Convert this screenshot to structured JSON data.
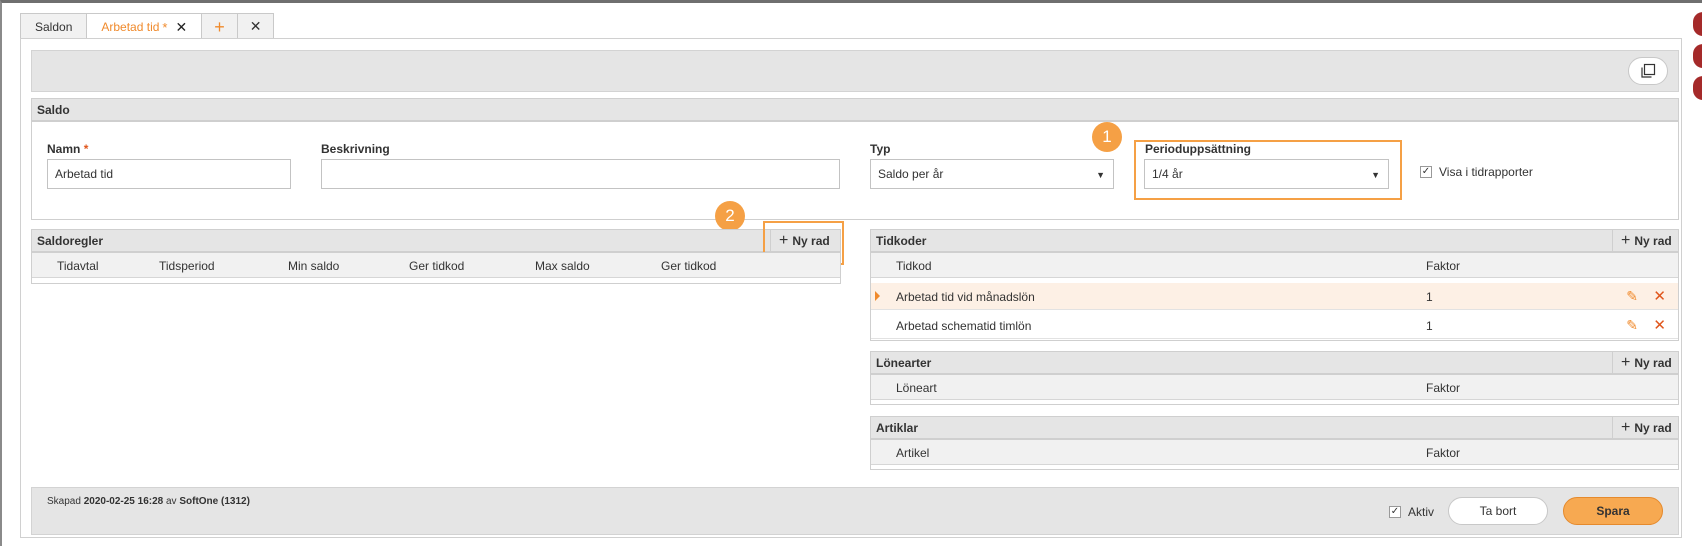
{
  "tabs": [
    {
      "label": "Saldon"
    },
    {
      "label": "Arbetad tid",
      "modified_marker": "*",
      "close": "✕"
    },
    {
      "add": "+"
    },
    {
      "close": "✕"
    }
  ],
  "saldo": {
    "title": "Saldo",
    "name_label": "Namn",
    "required_marker": "*",
    "name_value": "Arbetad tid",
    "description_label": "Beskrivning",
    "description_value": "",
    "type_label": "Typ",
    "type_value": "Saldo per år",
    "period_label": "Perioduppsättning",
    "period_value": "1/4 år",
    "show_in_reports_label": "Visa i tidrapporter",
    "show_in_reports_checked": true
  },
  "callouts": {
    "one": "1",
    "two": "2"
  },
  "saldoregler": {
    "title": "Saldoregler",
    "new_row": "Ny rad",
    "columns": [
      "Tidavtal",
      "Tidsperiod",
      "Min saldo",
      "Ger tidkod",
      "Max saldo",
      "Ger tidkod"
    ]
  },
  "tidkoder": {
    "title": "Tidkoder",
    "new_row": "Ny rad",
    "columns": [
      "Tidkod",
      "Faktor"
    ],
    "rows": [
      {
        "tidkod": "Arbetad tid vid månadslön",
        "faktor": "1"
      },
      {
        "tidkod": "Arbetad schematid timlön",
        "faktor": "1"
      }
    ]
  },
  "lonearter": {
    "title": "Lönearter",
    "new_row": "Ny rad",
    "columns": [
      "Löneart",
      "Faktor"
    ]
  },
  "artiklar": {
    "title": "Artiklar",
    "new_row": "Ny rad",
    "columns": [
      "Artikel",
      "Faktor"
    ]
  },
  "footer": {
    "created_prefix": "Skapad",
    "created_date": "2020-02-25 16:28",
    "created_by_prefix": "av",
    "created_by": "SoftOne (1312)",
    "active_label": "Aktiv",
    "active_checked": true,
    "delete_label": "Ta bort",
    "save_label": "Spara"
  },
  "colors": {
    "accent": "#f08a2c",
    "highlight": "#f5a045",
    "danger": "#e0561c"
  }
}
